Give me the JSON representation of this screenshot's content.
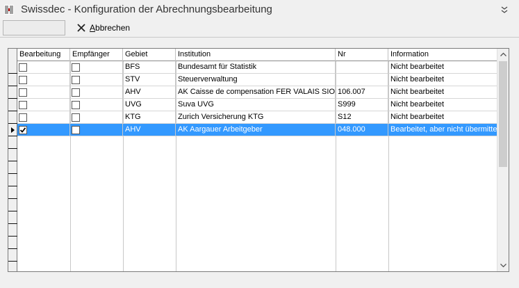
{
  "window": {
    "title": "Swissdec - Konfiguration der Abrechnungsbearbeitung"
  },
  "toolbar": {
    "cancel_prefix": "",
    "cancel_accel": "A",
    "cancel_rest": "bbrechen"
  },
  "grid": {
    "columns": [
      "Bearbeitung",
      "Empfänger",
      "Gebiet",
      "Institution",
      "Nr",
      "Information"
    ],
    "rows": [
      {
        "bearbeitung": false,
        "empfaenger": false,
        "gebiet": "BFS",
        "institution": "Bundesamt für Statistik",
        "nr": "",
        "information": "Nicht bearbeitet",
        "selected": false
      },
      {
        "bearbeitung": false,
        "empfaenger": false,
        "gebiet": "STV",
        "institution": "Steuerverwaltung",
        "nr": "",
        "information": "Nicht bearbeitet",
        "selected": false
      },
      {
        "bearbeitung": false,
        "empfaenger": false,
        "gebiet": "AHV",
        "institution": "AK Caisse de compensation FER VALAIS SION",
        "nr": "106.007",
        "information": "Nicht bearbeitet",
        "selected": false
      },
      {
        "bearbeitung": false,
        "empfaenger": false,
        "gebiet": "UVG",
        "institution": "Suva UVG",
        "nr": "S999",
        "information": "Nicht bearbeitet",
        "selected": false
      },
      {
        "bearbeitung": false,
        "empfaenger": false,
        "gebiet": "KTG",
        "institution": "Zurich Versicherung KTG",
        "nr": "S12",
        "information": "Nicht bearbeitet",
        "selected": false
      },
      {
        "bearbeitung": true,
        "empfaenger": false,
        "gebiet": "AHV",
        "institution": "AK Aargauer Arbeitgeber",
        "nr": "048.000",
        "information": "Bearbeitet, aber nicht übermittelt",
        "selected": true
      }
    ]
  },
  "colors": {
    "selection": "#3399ff",
    "background": "#f0f0f0"
  }
}
